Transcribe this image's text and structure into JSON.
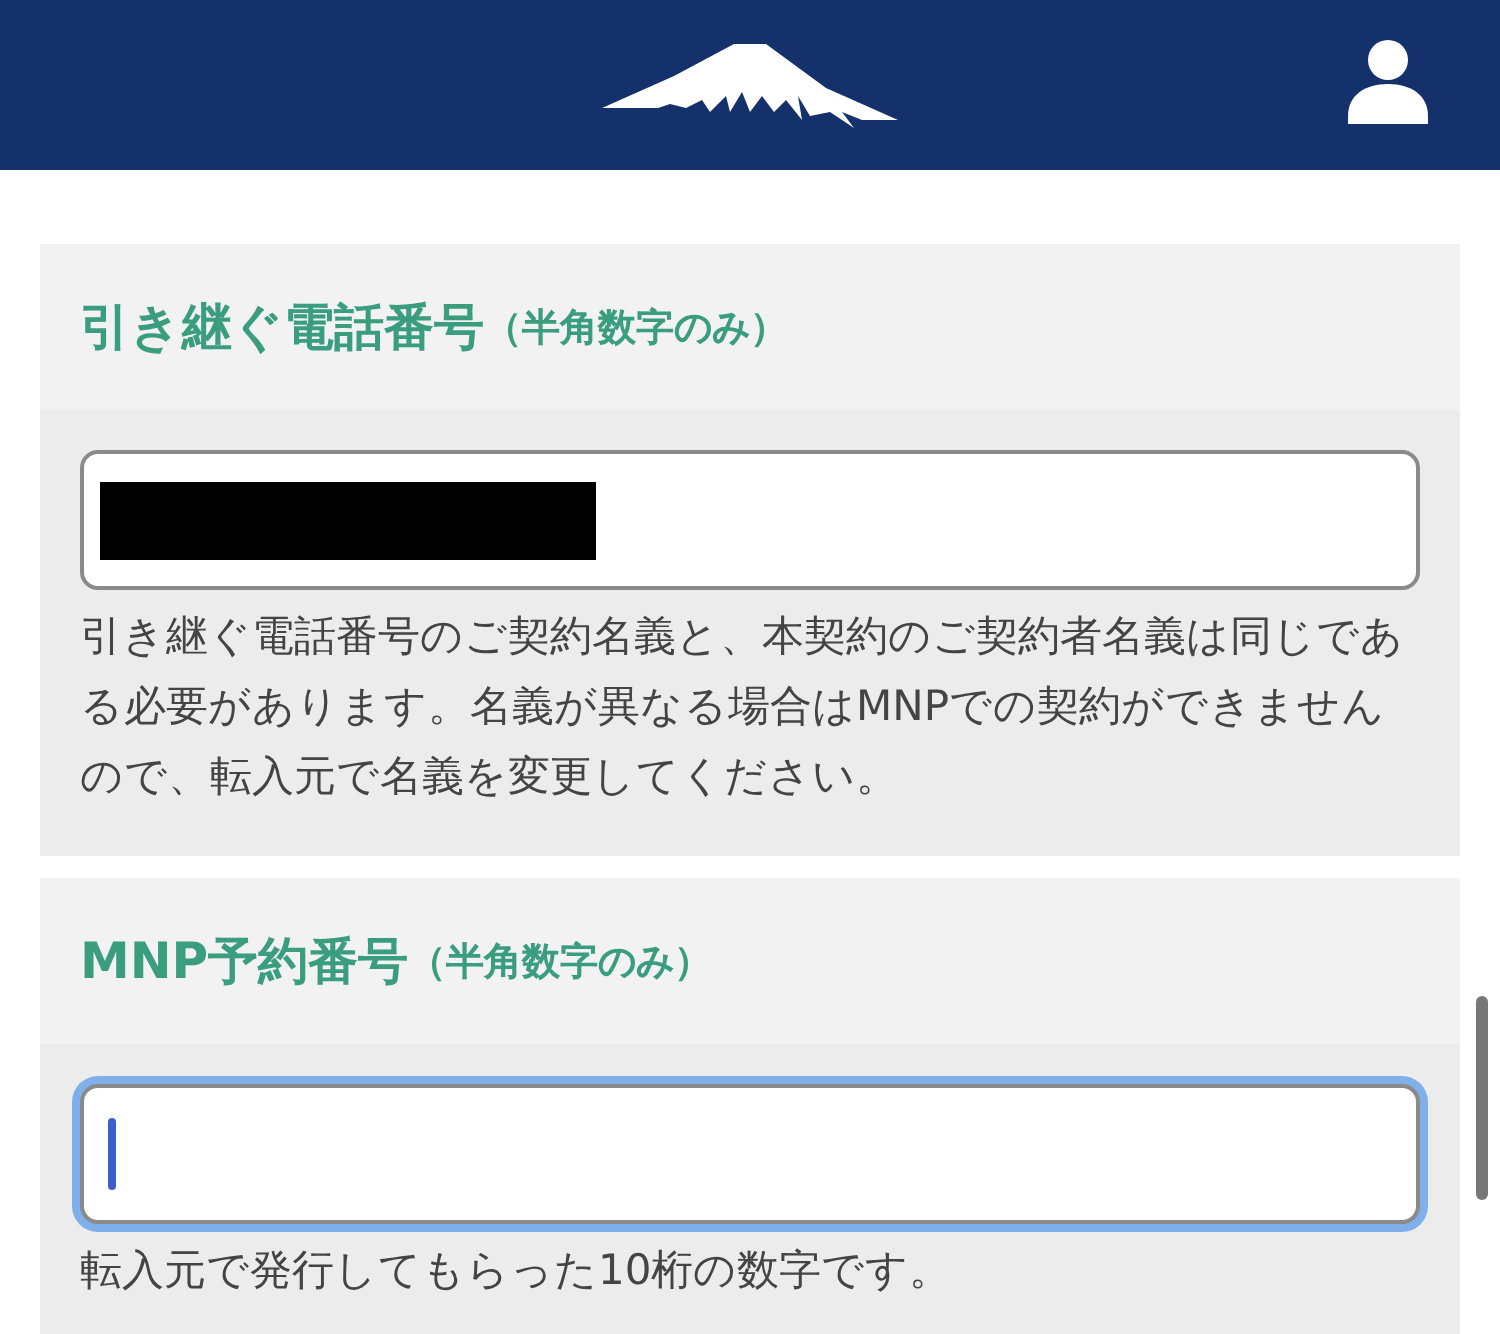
{
  "fields": [
    {
      "label": "引き継ぐ電話番号",
      "note": "（半角数字のみ）",
      "redacted": true,
      "focused": false,
      "help": "引き継ぐ電話番号のご契約名義と、本契約のご契約者名義は同じである必要があります。名義が異なる場合はMNPでの契約ができませんので、転入元で名義を変更してください。"
    },
    {
      "label": "MNP予約番号",
      "note": "（半角数字のみ）",
      "redacted": false,
      "focused": true,
      "help": "転入元で発行してもらった10桁の数字です。"
    }
  ]
}
